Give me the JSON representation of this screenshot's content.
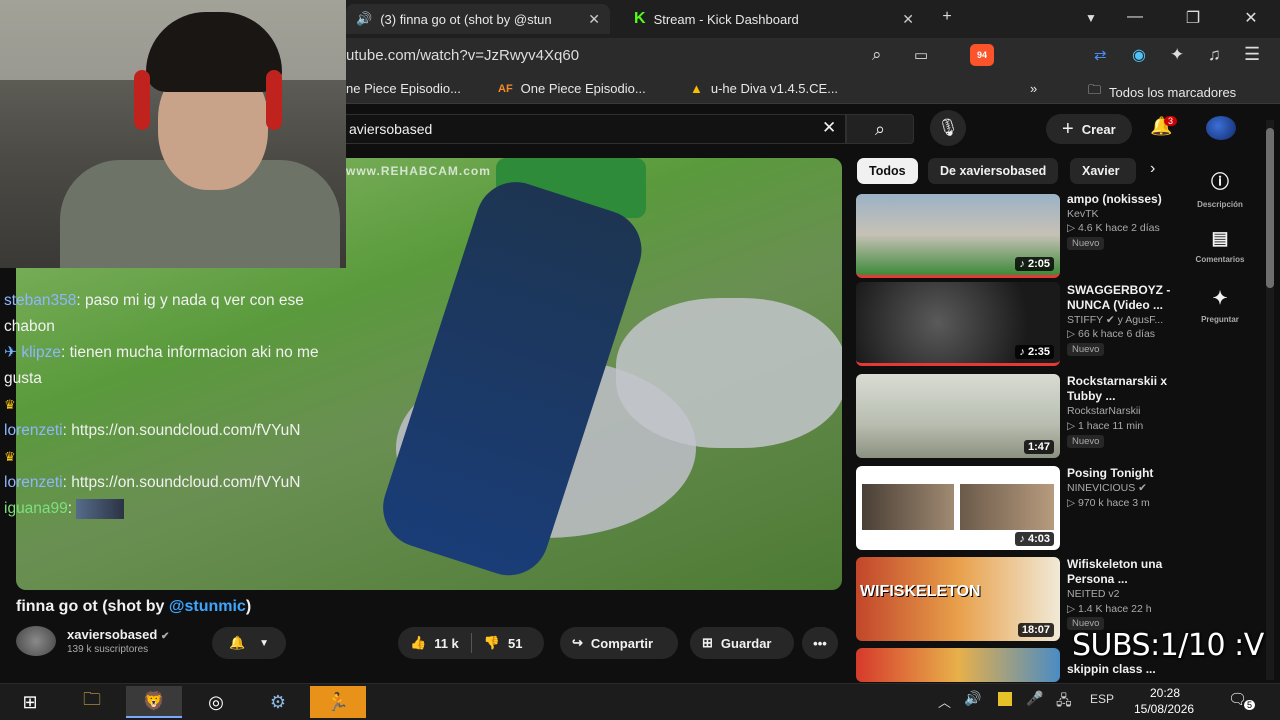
{
  "tabs": [
    {
      "label": "(3) finna go ot (shot by @stun",
      "active": true
    },
    {
      "label": "Stream - Kick Dashboard",
      "active": false
    }
  ],
  "address": {
    "url": "utube.com/watch?v=JzRwyv4Xq60",
    "brave_badge": "94"
  },
  "bookmarks": [
    "ne Piece Episodio...",
    "One Piece Episodio...",
    "u-he Diva v1.4.5.CE...",
    "Todos los marcadores"
  ],
  "youtube": {
    "search_value": "aviersobased",
    "create_label": "Crear",
    "notification_count": "3"
  },
  "video": {
    "watermark": "www.REHABCAM.com",
    "title_prefix": "finna go ot (shot by ",
    "title_mention": "@stunmic",
    "title_suffix": ")",
    "channel": "xaviersobased",
    "subscribers": "139 k suscriptores",
    "likes": "11 k",
    "dislikes": "51",
    "share_label": "Compartir",
    "save_label": "Guardar"
  },
  "chat": [
    {
      "user": "steban358",
      "text": "paso mi ig y nada q ver con ese chabon",
      "color": "#8fb6ff",
      "badge": ""
    },
    {
      "user": "klipze",
      "text": "tienen mucha informacion aki no me gusta",
      "color": "#8fb6ff",
      "badge": "✈"
    },
    {
      "user": "lorenzeti",
      "text": "https://on.soundcloud.com/fVYuN",
      "color": "#8fb6ff",
      "badge": "♛"
    },
    {
      "user": "lorenzeti",
      "text": "https://on.soundcloud.com/fVYuN",
      "color": "#8fb6ff",
      "badge": "♛"
    },
    {
      "user": "iguana99",
      "text": "",
      "color": "#7de07d",
      "badge": ""
    }
  ],
  "chips": [
    "Todos",
    "De xaviersobased",
    "Xavier"
  ],
  "side_actions": [
    {
      "icon": "info-icon",
      "label": "Descripción"
    },
    {
      "icon": "comment-icon",
      "label": "Comentarios"
    },
    {
      "icon": "sparkle-icon",
      "label": "Preguntar"
    }
  ],
  "recommendations": [
    {
      "title": "ampo (nokisses)",
      "channel": "KevTK",
      "stats": "▷ 4.6 K  hace 2 días",
      "badge": "Nuevo",
      "duration": "♪ 2:05"
    },
    {
      "title": "SWAGGERBOYZ - NUNCA (Video ...",
      "channel": "STIFFY ✔ y AgusF...",
      "stats": "▷ 66 k  hace 6 días",
      "badge": "Nuevo",
      "duration": "♪ 2:35"
    },
    {
      "title": "Rockstarnarskii x Tubby ...",
      "channel": "RockstarNarskii",
      "stats": "▷ 1  hace 11 min",
      "badge": "Nuevo",
      "duration": "1:47"
    },
    {
      "title": "Posing Tonight",
      "channel": "NINEVICIOUS ✔",
      "stats": "▷ 970 k  hace 3 m",
      "badge": "",
      "duration": "♪ 4:03"
    },
    {
      "title": "Wifiskeleton una Persona ...",
      "channel": "NEITED v2",
      "stats": "▷ 1.4 K  hace 22 h",
      "badge": "Nuevo",
      "duration": "18:07"
    },
    {
      "title": "skippin class ...",
      "channel": "",
      "stats": "",
      "badge": "",
      "duration": ""
    }
  ],
  "overlay_text": "SUBS:1/10 :V",
  "taskbar": {
    "lang": "ESP",
    "time": "20:28",
    "date": "15/08/2026",
    "notif": "5"
  }
}
